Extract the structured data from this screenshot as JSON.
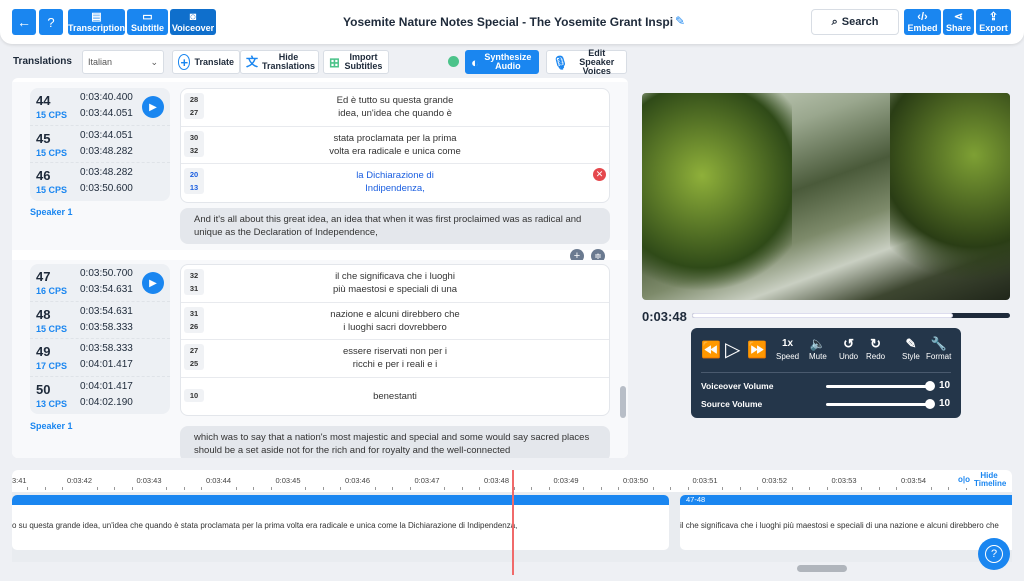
{
  "header": {
    "back_icon": "arrow-left-icon",
    "help_label": "?",
    "tabs": [
      {
        "label": "Transcription"
      },
      {
        "label": "Subtitle"
      },
      {
        "label": "Voiceover"
      }
    ],
    "title": "Yosemite Nature Notes Special - The Yosemite Grant Inspiring Gr",
    "search_label": "Search",
    "actions": [
      {
        "label": "Embed"
      },
      {
        "label": "Share"
      },
      {
        "label": "Export"
      }
    ]
  },
  "toolbar": {
    "translations_label": "Translations",
    "language": "Italian",
    "translate": "Translate",
    "hide_translations": "Hide Translations",
    "import_subtitles": "Import Subtitles",
    "synthesize": "Synthesize Audio",
    "edit_voices": "Edit Speaker Voices",
    "status_color": "#4cc38a"
  },
  "groups": [
    {
      "speaker": "Speaker 1",
      "segments": [
        {
          "num": "44",
          "cps": "15 CPS",
          "start": "0:03:40.400",
          "end": "0:03:44.051"
        },
        {
          "num": "45",
          "cps": "15 CPS",
          "start": "0:03:44.051",
          "end": "0:03:48.282"
        },
        {
          "num": "46",
          "cps": "15 CPS",
          "start": "0:03:48.282",
          "end": "0:03:50.600"
        }
      ],
      "lines": [
        {
          "c1": "28",
          "c2": "27",
          "l1": "Ed è tutto su questa grande",
          "l2": "idea, un'idea che quando è"
        },
        {
          "c1": "30",
          "c2": "32",
          "l1": "stata proclamata per la prima",
          "l2": "volta era radicale e unica come"
        },
        {
          "c1": "20",
          "c2": "13",
          "l1": "la Dichiarazione di",
          "l2": "Indipendenza,"
        }
      ],
      "source": "And it's all about this great idea, an idea that when it was first proclaimed was as radical and unique as the Declaration of Independence,"
    },
    {
      "speaker": "Speaker 1",
      "segments": [
        {
          "num": "47",
          "cps": "16 CPS",
          "start": "0:03:50.700",
          "end": "0:03:54.631"
        },
        {
          "num": "48",
          "cps": "15 CPS",
          "start": "0:03:54.631",
          "end": "0:03:58.333"
        },
        {
          "num": "49",
          "cps": "17 CPS",
          "start": "0:03:58.333",
          "end": "0:04:01.417"
        },
        {
          "num": "50",
          "cps": "13 CPS",
          "start": "0:04:01.417",
          "end": "0:04:02.190"
        }
      ],
      "lines": [
        {
          "c1": "32",
          "c2": "31",
          "l1": "il che significava che i luoghi",
          "l2": "più maestosi e speciali di una"
        },
        {
          "c1": "31",
          "c2": "26",
          "l1": "nazione e alcuni direbbero che",
          "l2": "i luoghi sacri dovrebbero"
        },
        {
          "c1": "27",
          "c2": "25",
          "l1": "essere riservati non per i",
          "l2": "ricchi e per i reali e i"
        },
        {
          "c1": "10",
          "l1": "benestanti"
        }
      ],
      "source": "which was to say that a nation's most majestic and special and some would say sacred places should be a set aside not for the rich and for royalty and the well-connected"
    }
  ],
  "player": {
    "time": "0:03:48",
    "progress": 0.82,
    "speed": "1x",
    "buttons": {
      "speed": "Speed",
      "mute": "Mute",
      "undo": "Undo",
      "redo": "Redo",
      "style": "Style",
      "format": "Format"
    },
    "voiceover_label": "Voiceover Volume",
    "voiceover_value": "10",
    "source_label": "Source Volume",
    "source_value": "10"
  },
  "timeline": {
    "ticks": [
      "3:41",
      "0:03:42",
      "0:03:43",
      "0:03:44",
      "0:03:45",
      "0:03:46",
      "0:03:47",
      "0:03:48",
      "0:03:49",
      "0:03:50",
      "0:03:51",
      "0:03:52",
      "0:03:53",
      "0:03:54"
    ],
    "hide_label": "Hide Timeline",
    "clip1_text": "o su questa grande idea, un'idea che quando è stata proclamata per la prima volta era radicale e unica come la Dichiarazione di Indipendenza,",
    "clip2_label": "47-48",
    "clip2_text": "il che significava che i luoghi più maestosi e speciali di una nazione e alcuni direbbero che"
  },
  "help_label": "?"
}
